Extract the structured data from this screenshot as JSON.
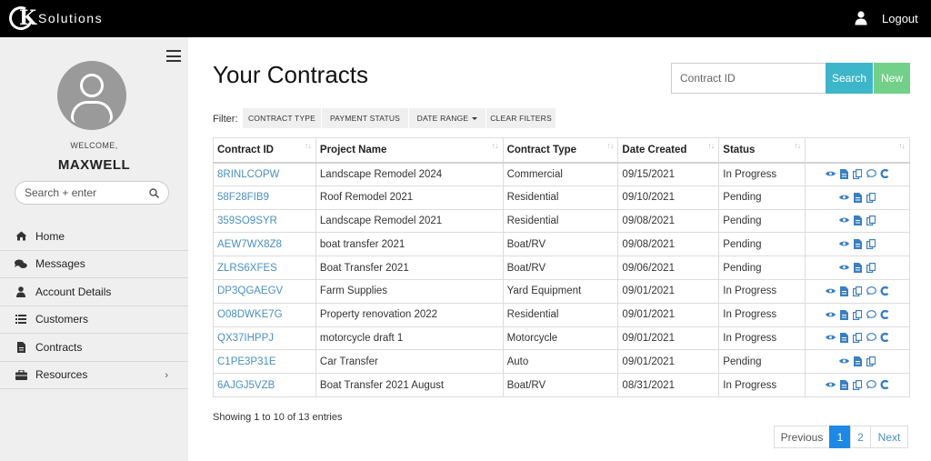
{
  "header": {
    "logo_text": "Solutions",
    "logout_label": "Logout"
  },
  "sidebar": {
    "welcome": "WELCOME,",
    "username": "MAXWELL",
    "search_placeholder": "Search + enter",
    "items": [
      {
        "label": "Home",
        "icon": "home-icon"
      },
      {
        "label": "Messages",
        "icon": "chat-icon"
      },
      {
        "label": "Account Details",
        "icon": "user-icon"
      },
      {
        "label": "Customers",
        "icon": "list-icon"
      },
      {
        "label": "Contracts",
        "icon": "document-icon"
      },
      {
        "label": "Resources",
        "icon": "briefcase-icon",
        "chevron": "›"
      }
    ]
  },
  "main": {
    "title": "Your Contracts",
    "search_placeholder": "Contract ID",
    "search_button": "Search",
    "new_button": "New",
    "filter_label": "Filter:",
    "filters": {
      "contract_type": "CONTRACT TYPE",
      "payment_status": "PAYMENT STATUS",
      "date_range": "DATE RANGE",
      "clear": "CLEAR FILTERS"
    },
    "table": {
      "columns": [
        "Contract ID",
        "Project Name",
        "Contract Type",
        "Date Created",
        "Status",
        ""
      ],
      "rows": [
        {
          "id": "8RINLCOPW",
          "project": "Landscape Remodel 2024",
          "type": "Commercial",
          "date": "09/15/2021",
          "status": "In Progress",
          "actions": [
            "view",
            "document",
            "copy",
            "comment",
            "refresh"
          ]
        },
        {
          "id": "58F28FIB9",
          "project": "Roof Remodel 2021",
          "type": "Residential",
          "date": "09/10/2021",
          "status": "Pending",
          "actions": [
            "view",
            "document",
            "copy"
          ]
        },
        {
          "id": "359SO9SYR",
          "project": "Landscape Remodel 2021",
          "type": "Residential",
          "date": "09/08/2021",
          "status": "Pending",
          "actions": [
            "view",
            "document",
            "copy"
          ]
        },
        {
          "id": "AEW7WX8Z8",
          "project": "boat transfer 2021",
          "type": "Boat/RV",
          "date": "09/08/2021",
          "status": "Pending",
          "actions": [
            "view",
            "document",
            "copy"
          ]
        },
        {
          "id": "ZLRS6XFES",
          "project": "Boat Transfer 2021",
          "type": "Boat/RV",
          "date": "09/06/2021",
          "status": "Pending",
          "actions": [
            "view",
            "document",
            "copy"
          ]
        },
        {
          "id": "DP3QGAEGV",
          "project": "Farm Supplies",
          "type": "Yard Equipment",
          "date": "09/01/2021",
          "status": "In Progress",
          "actions": [
            "view",
            "document",
            "copy",
            "comment",
            "refresh"
          ]
        },
        {
          "id": "O08DWKE7G",
          "project": "Property renovation 2022",
          "type": "Residential",
          "date": "09/01/2021",
          "status": "In Progress",
          "actions": [
            "view",
            "document",
            "copy",
            "comment",
            "refresh"
          ]
        },
        {
          "id": "QX37IHPPJ",
          "project": "motorcycle draft 1",
          "type": "Motorcycle",
          "date": "09/01/2021",
          "status": "In Progress",
          "actions": [
            "view",
            "document",
            "copy",
            "comment",
            "refresh"
          ]
        },
        {
          "id": "C1PE3P31E",
          "project": "Car Transfer",
          "type": "Auto",
          "date": "09/01/2021",
          "status": "Pending",
          "actions": [
            "view",
            "document",
            "copy"
          ]
        },
        {
          "id": "6AJGJ5VZB",
          "project": "Boat Transfer 2021 August",
          "type": "Boat/RV",
          "date": "08/31/2021",
          "status": "In Progress",
          "actions": [
            "view",
            "document",
            "copy",
            "comment",
            "refresh"
          ]
        }
      ]
    },
    "entries_text": "Showing 1 to 10 of 13 entries",
    "pagination": {
      "previous": "Previous",
      "pages": [
        "1",
        "2"
      ],
      "current": "1",
      "next": "Next"
    }
  },
  "colors": {
    "accent_search": "#3eb6c9",
    "accent_new": "#72d089",
    "link": "#4a8fc0",
    "icon": "#3a7fc1",
    "active_page": "#1e88e5"
  }
}
